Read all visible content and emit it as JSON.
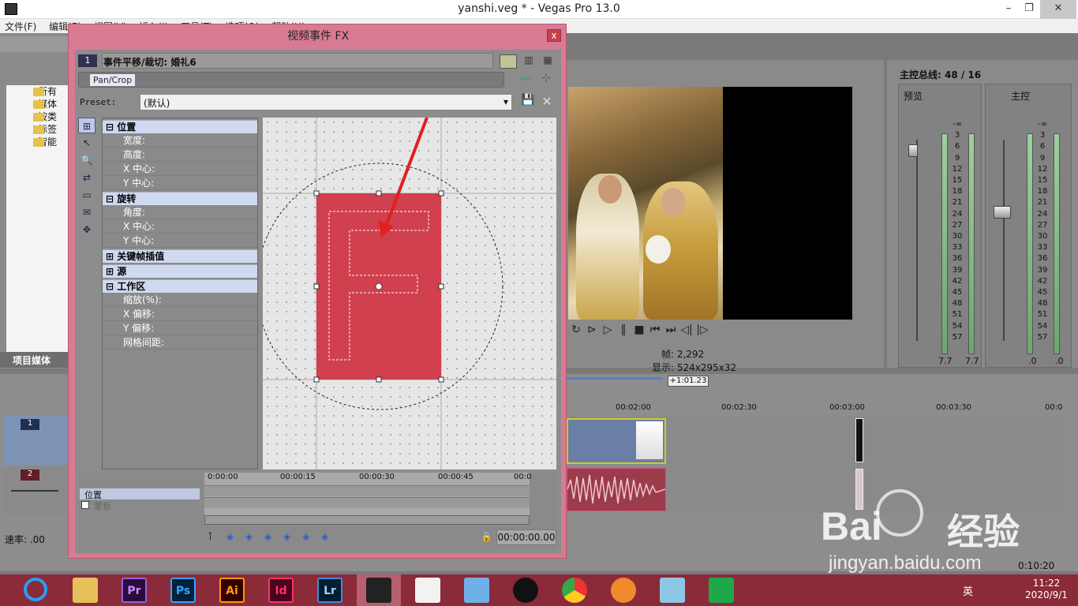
{
  "window": {
    "title": "yanshi.veg * - Vegas Pro 13.0",
    "minimize": "–",
    "maximize": "❐",
    "close": "✕"
  },
  "menu": [
    "文件(F)",
    "编辑(E)",
    "视图(V)",
    "插入(I)",
    "工具(T)",
    "选项(O)",
    "帮助(H)"
  ],
  "project_media": {
    "tree_items": [
      "所有",
      "媒体",
      "按类",
      "标签",
      "智能"
    ],
    "tab": "项目媒体"
  },
  "preview": {
    "frame_label": "帧:",
    "frame_value": "2,292",
    "display_label": "显示:",
    "display_value": "524x295x32"
  },
  "mixer": {
    "title": "主控总线: 48 / 16",
    "preview_label": "预览",
    "master_label": "主控",
    "scale": [
      "-∞",
      "3",
      "6",
      "9",
      "12",
      "15",
      "18",
      "21",
      "24",
      "27",
      "30",
      "33",
      "36",
      "39",
      "42",
      "45",
      "48",
      "51",
      "54",
      "57"
    ],
    "preview_values": [
      "7.7",
      "7.7"
    ],
    "master_values": [
      ".0",
      ".0"
    ]
  },
  "timeline": {
    "cursor_time": "+1:01.23",
    "ruler": [
      "00:02:00",
      "00:02:30",
      "00:03:00",
      "00:03:30",
      "00:0"
    ],
    "track1_num": "1",
    "track2_num": "2",
    "rate_label": "速率: .00",
    "bottom_time": "0:10:20"
  },
  "fx": {
    "title": "视频事件 FX",
    "close": "x",
    "chain_num": "1",
    "chain_title": "事件平移/裁切: 婚礼6",
    "plugin_chip": "Pan/Crop",
    "preset_label": "Preset:",
    "preset_value": "(默认)",
    "sections": {
      "position": {
        "title": "位置",
        "rows": [
          "宽度:",
          "高度:",
          "X 中心:",
          "Y 中心:"
        ]
      },
      "rotation": {
        "title": "旋转",
        "rows": [
          "角度:",
          "X 中心:",
          "Y 中心:"
        ]
      },
      "keyframe": {
        "title": "关键帧插值"
      },
      "source": {
        "title": "源"
      },
      "workspace": {
        "title": "工作区",
        "rows": [
          "缩放(%):",
          "X 偏移:",
          "Y 偏移:",
          "网格间距:"
        ]
      }
    },
    "kf": {
      "ruler": [
        "0:00:00",
        "00:00:15",
        "00:00:30",
        "00:00:45",
        "00:0"
      ],
      "position_label": "位置",
      "mask_label": "蒙板",
      "time": "00:00:00.00"
    },
    "canvas_letter": "F"
  },
  "taskbar": {
    "apps": [
      "Pr",
      "Ps",
      "Ai",
      "Id",
      "Lr"
    ],
    "time": "11:22",
    "date": "2020/9/1",
    "ime": "英"
  },
  "watermark": {
    "brand": "Bai",
    "brand_cn": "经验",
    "url": "jingyan.baidu.com"
  },
  "colors": {
    "dialog_frame": "#d97a93",
    "crop_box": "#d0404e",
    "taskbar": "#8b2a38",
    "arrow": "#e02020"
  }
}
